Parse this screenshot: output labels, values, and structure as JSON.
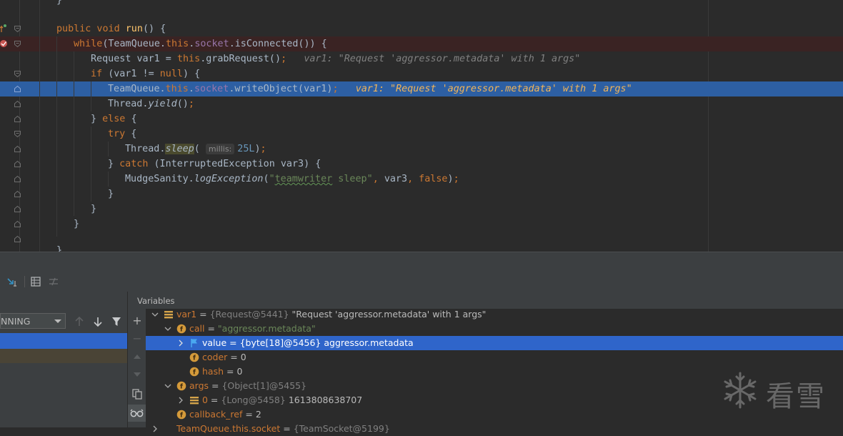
{
  "editor": {
    "lines": [
      {
        "id": "L0",
        "html": "<span class=\"dim\">}</span>"
      },
      {
        "id": "L1",
        "html": "<span class=\"kw\">public void </span><span class=\"fn\">run</span>() {"
      },
      {
        "id": "L2",
        "html": "<span class=\"kw\">while</span>(TeamQueue.<span class=\"kw\">this</span>.<span class=\"fld\">socket</span>.isConnected()) {"
      },
      {
        "id": "L3",
        "html": "Request var1 = <span class=\"kw\">this</span>.grabRequest()<span class=\"kw\">;</span>   <span class=\"cmt\">var1: \"Request 'aggressor.metadata' with 1 args\"</span>"
      },
      {
        "id": "L4",
        "html": "<span class=\"kw\">if </span>(var1 != <span class=\"kw\">null</span>) {"
      },
      {
        "id": "L5",
        "html": "TeamQueue.<span class=\"kw\">this</span>.<span class=\"fld\">socket</span>.writeObject(var1)<span class=\"kw\">;</span>   <span class=\"cmt-exec\">var1: \"Request 'aggressor.metadata' with 1 args\"</span>"
      },
      {
        "id": "L6",
        "html": "Thread.<span class=\"it\">yield</span>()<span class=\"kw\">;</span>"
      },
      {
        "id": "L7",
        "html": "} <span class=\"kw\">else </span>{"
      },
      {
        "id": "L8",
        "html": "<span class=\"kw\">try </span>{"
      },
      {
        "id": "L9",
        "html": "Thread.<span class=\"it sleep-hl\">sleep</span>( <span class=\"hint\">millis:</span><span class=\"num\">25L</span>)<span class=\"kw\">;</span>"
      },
      {
        "id": "L10",
        "html": "} <span class=\"kw\">catch </span>(InterruptedException var3) {"
      },
      {
        "id": "L11",
        "html": "MudgeSanity.<span class=\"it\">logException</span>(<span class=\"str\">\"<span class=\"squig\">teamwriter</span> sleep\"</span><span class=\"kw\">, </span>var3<span class=\"kw\">, false</span>)<span class=\"kw\">;</span>"
      },
      {
        "id": "L12",
        "html": "}"
      },
      {
        "id": "L13",
        "html": "}"
      },
      {
        "id": "L14",
        "html": "}"
      },
      {
        "id": "L15",
        "html": "}"
      }
    ]
  },
  "frames": {
    "thread_status": "NNING"
  },
  "variables": {
    "header": "Variables",
    "rows": [
      {
        "name": "var1",
        "sep": " = ",
        "ref": "{Request@5441} ",
        "value": "\"Request 'aggressor.metadata' with 1 args\"",
        "value_kind": "plain"
      },
      {
        "name": "call",
        "sep": " = ",
        "ref": "",
        "value": "\"aggressor.metadata\"",
        "value_kind": "str"
      },
      {
        "name": "value",
        "sep": " = ",
        "ref": "{byte[18]@5456} ",
        "value": "aggressor.metadata",
        "value_kind": "plain"
      },
      {
        "name": "coder",
        "sep": " = ",
        "ref": "",
        "value": "0",
        "value_kind": "plain"
      },
      {
        "name": "hash",
        "sep": " = ",
        "ref": "",
        "value": "0",
        "value_kind": "plain"
      },
      {
        "name": "args",
        "sep": " = ",
        "ref": "{Object[1]@5455}",
        "value": "",
        "value_kind": "plain"
      },
      {
        "name": "0",
        "sep": " = ",
        "ref": "{Long@5458} ",
        "value": "1613808638707",
        "value_kind": "plain"
      },
      {
        "name": "callback_ref",
        "sep": " = ",
        "ref": "",
        "value": "2",
        "value_kind": "plain"
      },
      {
        "name": "TeamQueue.this.socket",
        "sep": " = ",
        "ref": "{TeamSocket@5199}",
        "value": "",
        "value_kind": "plain"
      }
    ]
  },
  "watermark": {
    "text": "看雪",
    "icon": "snowflake-icon"
  },
  "colors": {
    "editor_bg": "#2b2b2b",
    "exec_line": "#2d5fa3",
    "breakpoint_line": "#3a2323",
    "selection": "#2f65ca",
    "keyword": "#cc7832"
  }
}
